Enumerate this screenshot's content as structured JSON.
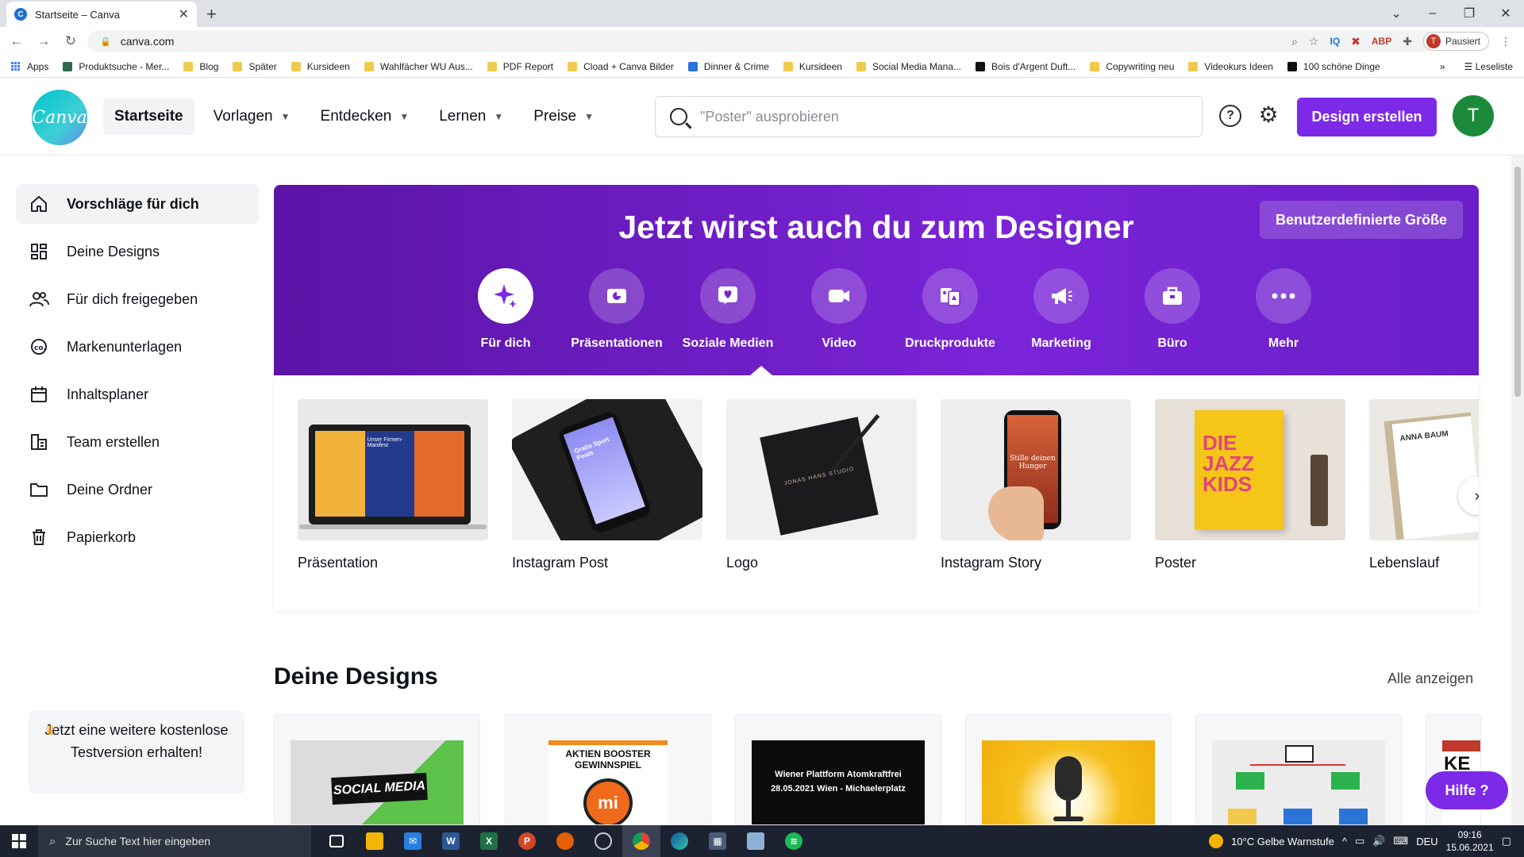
{
  "browser": {
    "tab_title": "Startseite – Canva",
    "tab_close": "✕",
    "new_tab": "+",
    "url": "canva.com",
    "profile_label": "Pausiert",
    "profile_initial": "T",
    "ext_iq": "IQ",
    "ext_abp": "ABP",
    "bookmarks": [
      "Apps",
      "Produktsuche - Mer...",
      "Blog",
      "Später",
      "Kursideen",
      "Wahlfächer WU Aus...",
      "PDF Report",
      "Cload + Canva Bilder",
      "Dinner & Crime",
      "Kursideen",
      "Social Media Mana...",
      "Bois d'Argent Duft...",
      "Copywriting neu",
      "Videokurs Ideen",
      "100 schöne Dinge"
    ],
    "bookmarks_more": "»",
    "reading_list": "Leseliste"
  },
  "header": {
    "logo_text": "Canva",
    "nav": [
      "Startseite",
      "Vorlagen",
      "Entdecken",
      "Lernen",
      "Preise"
    ],
    "search_placeholder": "\"Poster\" ausprobieren",
    "help_glyph": "?",
    "create_button": "Design erstellen",
    "avatar_initial": "T"
  },
  "sidebar": {
    "items": [
      "Vorschläge für dich",
      "Deine Designs",
      "Für dich freigegeben",
      "Markenunterlagen",
      "Inhaltsplaner",
      "Team erstellen",
      "Deine Ordner",
      "Papierkorb"
    ],
    "promo": "Jetzt eine weitere kostenlose Testversion erhalten!"
  },
  "hero": {
    "title": "Jetzt wirst auch du zum Designer",
    "custom_size_button": "Benutzerdefinierte Größe",
    "categories": [
      "Für dich",
      "Präsentationen",
      "Soziale Medien",
      "Video",
      "Druckprodukte",
      "Marketing",
      "Büro",
      "Mehr"
    ]
  },
  "templates": [
    {
      "name": "Präsentation",
      "thumb_text": "Unser Firmen-Manifest"
    },
    {
      "name": "Instagram Post",
      "thumb_text": "Gratis Sport Posts"
    },
    {
      "name": "Logo",
      "thumb_text": "JONAS HANS STUDIO"
    },
    {
      "name": "Instagram Story",
      "thumb_text": "Stille deinen Hunger"
    },
    {
      "name": "Poster",
      "thumb_text": "DIE JAZZ KIDS"
    },
    {
      "name": "Lebenslauf",
      "thumb_text": "ANNA BAUM"
    }
  ],
  "designs": {
    "title": "Deine Designs",
    "show_all": "Alle anzeigen",
    "cards": [
      {
        "text": "SOCIAL MEDIA"
      },
      {
        "text": "AKTIEN BOOSTER GEWINNSPIEL",
        "accent": "BOOSTER"
      },
      {
        "text": "Wiener Plattform Atomkraftfrei 28.05.2021 Wien - Michaelerplatz"
      },
      {
        "text": ""
      },
      {
        "text": ""
      },
      {
        "text": "KE"
      }
    ]
  },
  "help_button": "Hilfe ?",
  "taskbar": {
    "search_placeholder": "Zur Suche Text hier eingeben",
    "weather": "10°C  Gelbe Warnstufe",
    "language": "DEU",
    "time": "09:16",
    "date": "15.06.2021"
  },
  "colors": {
    "brand_purple": "#7d2ae8",
    "hero_purple": "#6a1fc9",
    "canva_teal": "#00c4cc",
    "avatar_green": "#1b8a3a"
  }
}
